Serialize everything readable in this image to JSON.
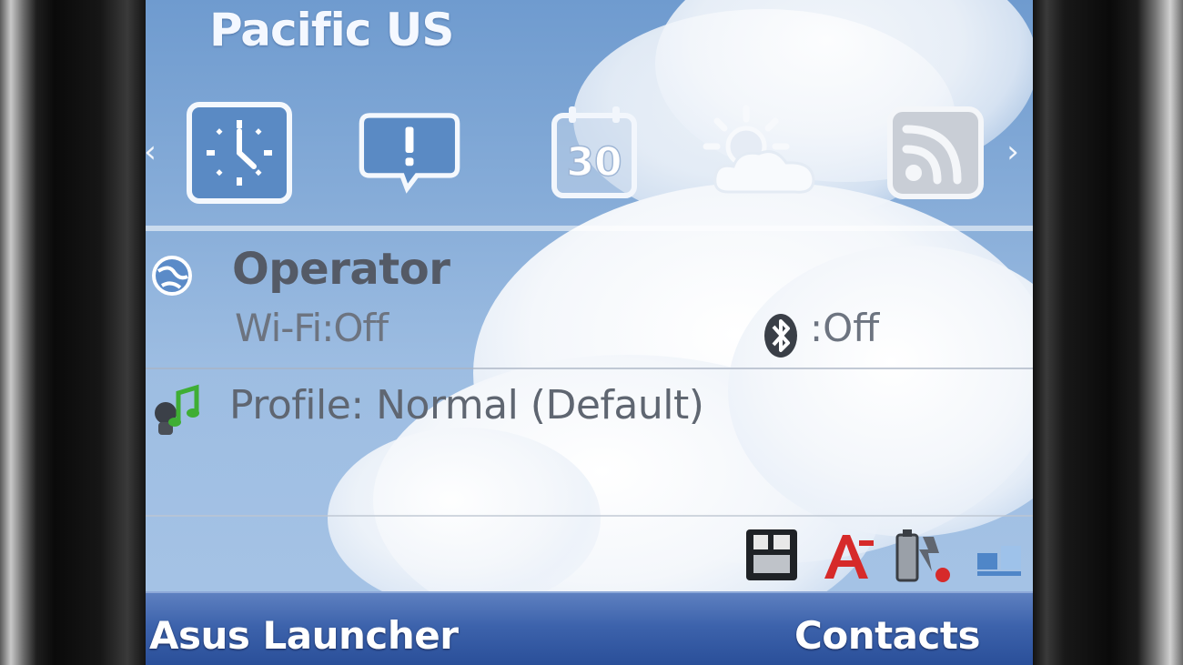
{
  "header": {
    "region": "Pacific US"
  },
  "icon_strip": {
    "tiles": [
      {
        "name": "clock",
        "icon": "clock-icon"
      },
      {
        "name": "alerts",
        "icon": "alert-bubble-icon"
      },
      {
        "name": "calendar",
        "icon": "calendar-icon",
        "label": "30"
      },
      {
        "name": "weather",
        "icon": "sun-cloud-icon"
      },
      {
        "name": "rss",
        "icon": "rss-feed-icon"
      }
    ],
    "prev_arrow": "‹",
    "next_arrow": "›"
  },
  "network": {
    "operator": "Operator",
    "wifi_status": "Wi-Fi:Off",
    "bluetooth_status": ":Off"
  },
  "profile": {
    "label": "Profile: Normal (Default)"
  },
  "status_icons": [
    "sim-card-icon",
    "text-input-icon",
    "battery-charging-icon",
    "network-icon"
  ],
  "softkeys": {
    "left": "Asus Launcher",
    "right": "Contacts"
  },
  "colors": {
    "sky": "#86acd8",
    "softkey_bar": "#3d63ac",
    "tile_selected": "#5a8ac4"
  }
}
